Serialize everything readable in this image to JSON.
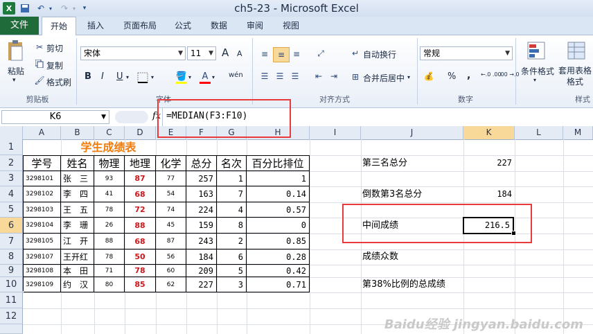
{
  "window": {
    "title": "ch5-23 - Microsoft Excel",
    "app_icon": "X"
  },
  "tabs": [
    "文件",
    "开始",
    "插入",
    "页面布局",
    "公式",
    "数据",
    "审阅",
    "视图"
  ],
  "ribbon": {
    "clipboard": {
      "paste": "粘贴",
      "cut": "剪切",
      "copy": "复制",
      "format_painter": "格式刷",
      "label": "剪贴板"
    },
    "font": {
      "name": "宋体",
      "size": "11",
      "label": "字体",
      "bold": "B",
      "italic": "I",
      "underline": "U",
      "grow": "A",
      "shrink": "A",
      "wen": "wén",
      "font_color": "A",
      "highlight_color": "#ffff00",
      "font_color_value": "#ff0000"
    },
    "alignment": {
      "wrap": "自动换行",
      "merge": "合并后居中",
      "label": "对齐方式"
    },
    "number": {
      "format": "常规",
      "percent": "%",
      "comma": ",",
      "label": "数字",
      "inc": "←.0 .00",
      "dec": ".00 →.0"
    },
    "styles": {
      "conditional": "条件格式",
      "table": "套用表格格式",
      "label": "样式"
    }
  },
  "formula_bar": {
    "cell": "K6",
    "fx": "fx",
    "formula": "=MEDIAN(F3:F10)"
  },
  "columns": [
    "A",
    "B",
    "C",
    "D",
    "E",
    "F",
    "G",
    "H",
    "I",
    "J",
    "K",
    "L",
    "M"
  ],
  "rows": [
    "1",
    "2",
    "3",
    "4",
    "5",
    "6",
    "7",
    "8",
    "9",
    "10",
    "11",
    "12"
  ],
  "sheet": {
    "title": "学生成绩表",
    "headers": [
      "学号",
      "姓名",
      "物理",
      "地理",
      "化学",
      "总分",
      "名次",
      "百分比排位"
    ],
    "records": [
      [
        "3298101",
        "张　三",
        "93",
        "87",
        "77",
        "257",
        "1",
        "1"
      ],
      [
        "3298102",
        "李　四",
        "41",
        "68",
        "54",
        "163",
        "7",
        "0.14"
      ],
      [
        "3298103",
        "王　五",
        "78",
        "72",
        "74",
        "224",
        "4",
        "0.57"
      ],
      [
        "3298104",
        "李　珊",
        "26",
        "88",
        "45",
        "159",
        "8",
        "0"
      ],
      [
        "3298105",
        "江　开",
        "88",
        "68",
        "87",
        "243",
        "2",
        "0.85"
      ],
      [
        "3298107",
        "王开红",
        "78",
        "50",
        "56",
        "184",
        "6",
        "0.28"
      ],
      [
        "3298108",
        "本　田",
        "71",
        "78",
        "60",
        "209",
        "5",
        "0.42"
      ],
      [
        "3298109",
        "约　汉",
        "80",
        "85",
        "62",
        "227",
        "3",
        "0.71"
      ]
    ],
    "side": [
      {
        "label": "第三名总分",
        "value": "227"
      },
      {
        "label": "倒数第3名总分",
        "value": "184"
      },
      {
        "label": "中间成绩",
        "value": "216.5"
      },
      {
        "label": "成绩众数",
        "value": ""
      },
      {
        "label": "第38%比例的总成绩",
        "value": ""
      }
    ]
  },
  "watermark": "Baidu经验 jingyan.baidu.com",
  "colors": {
    "file_tab": "#1f6b3a",
    "highlight": "#f9d99a",
    "red_box": "#e83a3a",
    "red_text": "#d0161b",
    "title_orange": "#f07c0c"
  }
}
